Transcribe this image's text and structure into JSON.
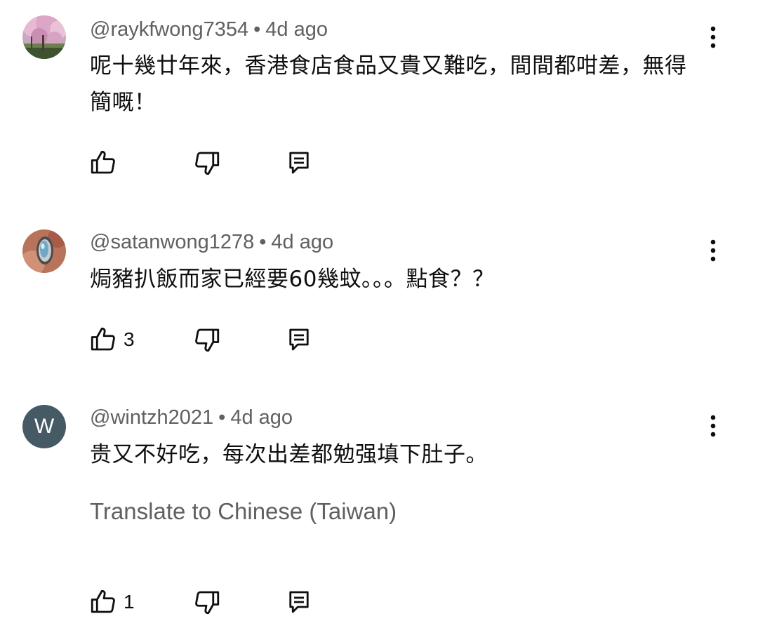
{
  "comments": [
    {
      "handle": "@raykfwong7354",
      "separator": "•",
      "time": "4d ago",
      "text": "呢十幾廿年來，香港食店食品又貴又難吃，間間都咁差，無得簡嘅！",
      "likes": "",
      "avatar_icon": "cherry-blossom-photo"
    },
    {
      "handle": "@satanwong1278",
      "separator": "•",
      "time": "4d ago",
      "text": "焗豬扒飯而家已經要60幾蚊。。。點食？？",
      "likes": "3",
      "avatar_icon": "gemstone-photo"
    },
    {
      "handle": "@wintzh2021",
      "separator": "•",
      "time": "4d ago",
      "text": "贵又不好吃，每次出差都勉强填下肚子。",
      "translate": "Translate to Chinese (Taiwan)",
      "likes": "1",
      "avatar_letter": "W",
      "avatar_color": "#455a64"
    }
  ],
  "icons": {
    "like": "thumbs-up-icon",
    "dislike": "thumbs-down-icon",
    "reply": "reply-icon",
    "menu": "more-vert-icon"
  }
}
